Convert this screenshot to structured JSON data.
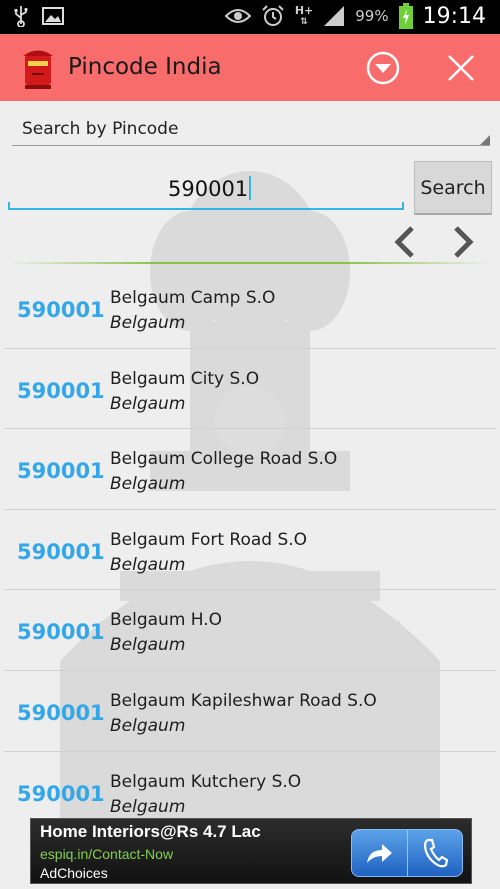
{
  "status_bar": {
    "left_icons": [
      "usb-icon",
      "image-icon"
    ],
    "right_icons": [
      "eye-icon",
      "alarm-icon",
      "network-icon",
      "signal-icon",
      "battery-icon"
    ],
    "network_type": "H+",
    "battery_percent": "99%",
    "time": "19:14"
  },
  "header": {
    "title": "Pincode India",
    "logo_icon": "post-box-icon",
    "menu_icon": "dropdown-circle-icon",
    "close_icon": "close-icon",
    "background_color": "#f86c6c"
  },
  "search": {
    "type_label": "Search by Pincode",
    "input_value": "590001",
    "button_label": "Search"
  },
  "pagination": {
    "prev_icon": "chevron-left-icon",
    "next_icon": "chevron-right-icon"
  },
  "results": [
    {
      "pincode": "590001",
      "office": "Belgaum Camp S.O",
      "district": "Belgaum"
    },
    {
      "pincode": "590001",
      "office": "Belgaum City S.O",
      "district": "Belgaum"
    },
    {
      "pincode": "590001",
      "office": "Belgaum College Road S.O",
      "district": "Belgaum"
    },
    {
      "pincode": "590001",
      "office": "Belgaum Fort Road S.O",
      "district": "Belgaum"
    },
    {
      "pincode": "590001",
      "office": "Belgaum H.O",
      "district": "Belgaum"
    },
    {
      "pincode": "590001",
      "office": "Belgaum Kapileshwar Road S.O",
      "district": "Belgaum"
    },
    {
      "pincode": "590001",
      "office": "Belgaum Kutchery S.O",
      "district": "Belgaum"
    }
  ],
  "ad": {
    "title": "Home Interiors@Rs 4.7 Lac",
    "url": "espiq.in/Contact-Now",
    "choices_label": "AdChoices",
    "button_icons": [
      "share-arrow-icon",
      "phone-icon"
    ]
  },
  "colors": {
    "accent": "#33b5e5",
    "pincode_text": "#33a7e8",
    "ad_url": "#82cf4f"
  }
}
